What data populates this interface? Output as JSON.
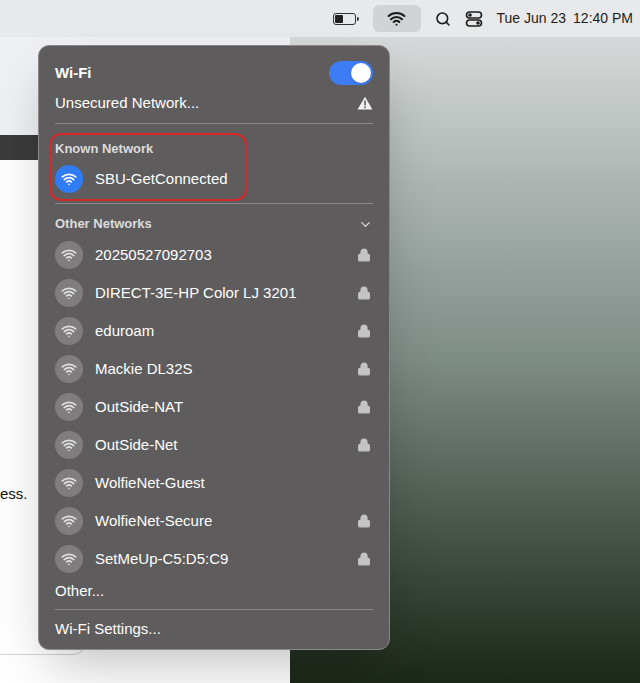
{
  "menu_bar": {
    "battery": {
      "level": 0.45
    },
    "wifi": {
      "selected": true
    },
    "date": "Tue Jun 23",
    "time": "12:40 PM"
  },
  "background_window": {
    "text": "ess."
  },
  "wifi_menu": {
    "title": "Wi-Fi",
    "on": true,
    "unsecured": {
      "label": "Unsecured Network..."
    },
    "known_section": {
      "header": "Known Network",
      "circled": true,
      "networks": [
        {
          "name": "SBU-GetConnected",
          "connected": true,
          "secured": false
        }
      ]
    },
    "other_section": {
      "header": "Other Networks",
      "expanded": true,
      "networks": [
        {
          "name": "20250527092703",
          "connected": false,
          "secured": true
        },
        {
          "name": "DIRECT-3E-HP Color LJ 3201",
          "connected": false,
          "secured": true
        },
        {
          "name": "eduroam",
          "connected": false,
          "secured": true
        },
        {
          "name": "Mackie DL32S",
          "connected": false,
          "secured": true
        },
        {
          "name": "OutSide-NAT",
          "connected": false,
          "secured": true
        },
        {
          "name": "OutSide-Net",
          "connected": false,
          "secured": true
        },
        {
          "name": "WolfieNet-Guest",
          "connected": false,
          "secured": false
        },
        {
          "name": "WolfieNet-Secure",
          "connected": false,
          "secured": true
        },
        {
          "name": "SetMeUp-C5:D5:C9",
          "connected": false,
          "secured": true
        }
      ]
    },
    "other": "Other...",
    "settings": "Wi-Fi Settings..."
  }
}
